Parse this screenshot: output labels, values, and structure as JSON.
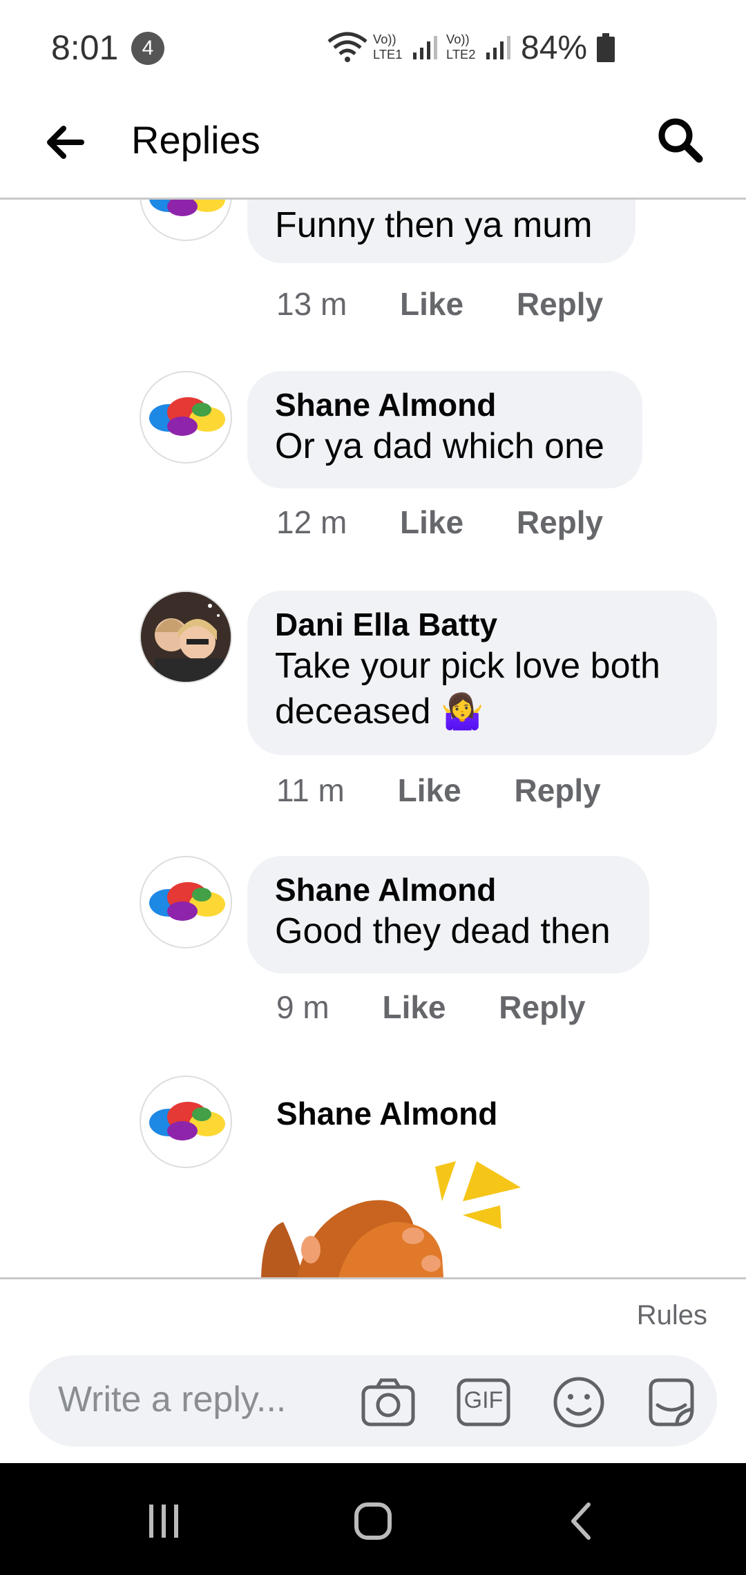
{
  "status": {
    "time": "8:01",
    "notifications": "4",
    "sim1": "LTE1",
    "sim2": "LTE2",
    "volte": "Vo))",
    "battery": "84%"
  },
  "header": {
    "title": "Replies"
  },
  "comments": [
    {
      "author": "",
      "text": "Funny then ya mum",
      "time": "13 m",
      "like": "Like",
      "reply": "Reply"
    },
    {
      "author": "Shane Almond",
      "text": "Or ya dad which one",
      "time": "12 m",
      "like": "Like",
      "reply": "Reply"
    },
    {
      "author": "Dani Ella Batty",
      "text": "Take your pick love both deceased",
      "emoji": "🤷‍♀️",
      "time": "11 m",
      "like": "Like",
      "reply": "Reply"
    },
    {
      "author": "Shane Almond",
      "text": "Good they dead then",
      "time": "9 m",
      "like": "Like",
      "reply": "Reply"
    },
    {
      "author": "Shane Almond",
      "sticker": "clapping-hands-sticker"
    }
  ],
  "reply_bar": {
    "rules": "Rules",
    "placeholder": "Write a reply...",
    "gif": "GIF"
  }
}
